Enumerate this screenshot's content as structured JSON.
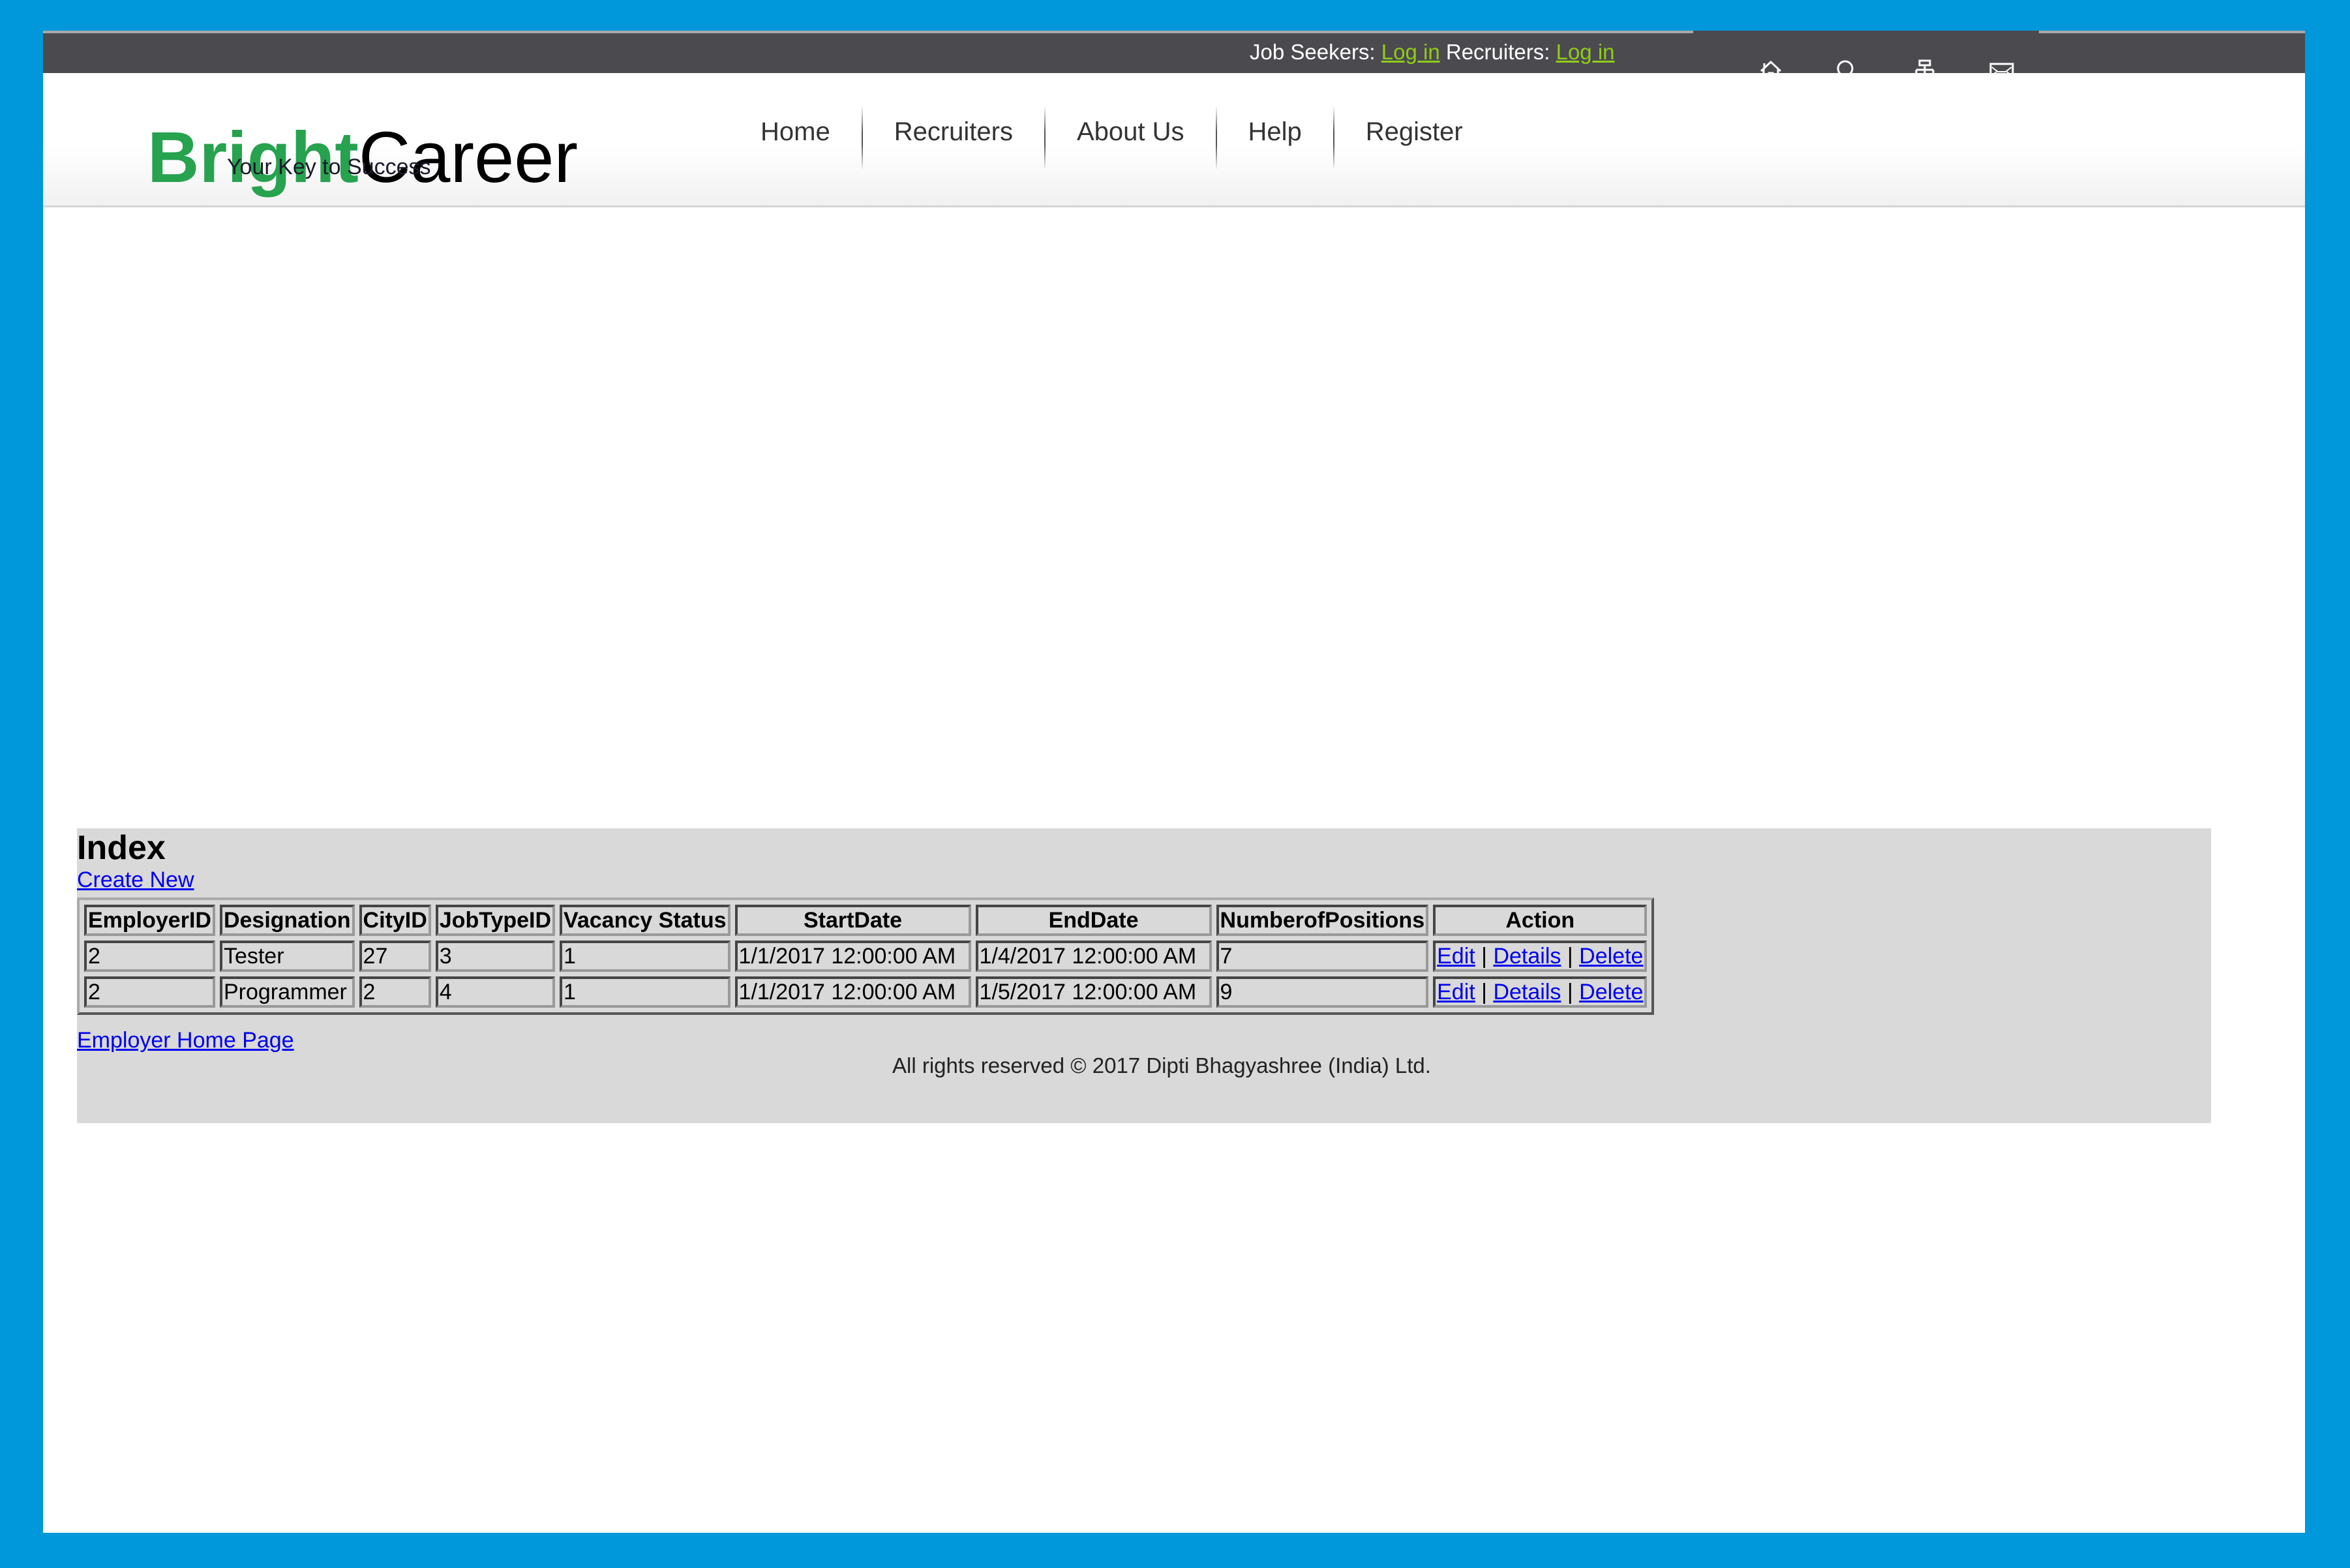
{
  "topbar": {
    "job_seekers_label": "Job Seekers:",
    "job_seekers_login": "Log in",
    "recruiters_label": "Recruiters:",
    "recruiters_login": "Log in",
    "link_color": "#8fcc1a",
    "icons": [
      "home-icon",
      "search-icon",
      "sitemap-icon",
      "mail-icon"
    ]
  },
  "brand": {
    "part1": "Bright",
    "part2": "Career",
    "tagline": "Your Key to Success",
    "accent": "#27a24f"
  },
  "nav": [
    "Home",
    "Recruiters",
    "About Us",
    "Help",
    "Register"
  ],
  "content": {
    "title": "Index",
    "create_new": "Create New",
    "columns": [
      "EmployerID",
      "Designation",
      "CityID",
      "JobTypeID",
      "Vacancy Status",
      "StartDate",
      "EndDate",
      "NumberofPositions",
      "Action"
    ],
    "rows": [
      {
        "EmployerID": "2",
        "Designation": "Tester",
        "CityID": "27",
        "JobTypeID": "3",
        "VacancyStatus": "1",
        "StartDate": "1/1/2017 12:00:00 AM",
        "EndDate": "1/4/2017 12:00:00 AM",
        "NumberofPositions": "7"
      },
      {
        "EmployerID": "2",
        "Designation": "Programmer",
        "CityID": "2",
        "JobTypeID": "4",
        "VacancyStatus": "1",
        "StartDate": "1/1/2017 12:00:00 AM",
        "EndDate": "1/5/2017 12:00:00 AM",
        "NumberofPositions": "9"
      }
    ],
    "actions": {
      "edit": "Edit",
      "details": "Details",
      "delete": "Delete",
      "sep": "|"
    },
    "employer_home": "Employer Home Page",
    "footer": "All rights reserved © 2017 Dipti Bhagyashree (India) Ltd."
  },
  "colors": {
    "frame": "#0098da",
    "topbar": "#4b4a4f",
    "panel": "#d9d9d9",
    "link": "#0000ee"
  }
}
